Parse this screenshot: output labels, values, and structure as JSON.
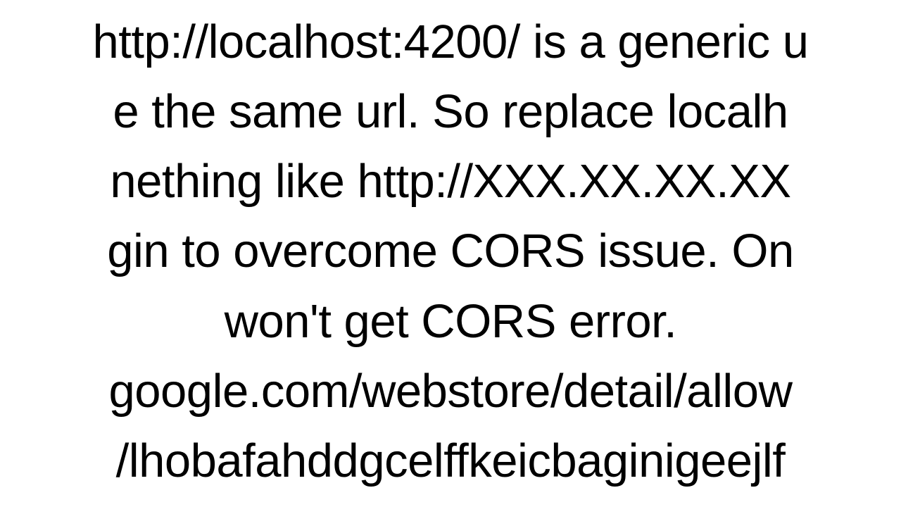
{
  "text": {
    "line1": "http://localhost:4200/ is a generic u",
    "line2": "e the same url. So replace localh",
    "line3": "nething like http://XXX.XX.XX.XX",
    "line4": "gin to overcome CORS issue. On",
    "line5": "won't get CORS error.",
    "line6": "google.com/webstore/detail/allow",
    "line7": "/lhobafahddgcelffkeicbaginigeejlf"
  }
}
